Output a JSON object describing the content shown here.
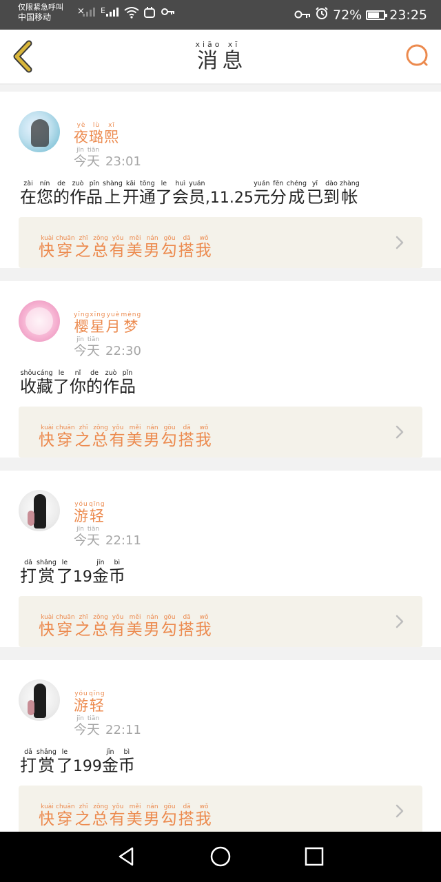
{
  "status_bar": {
    "carrier_line1": "仅限紧急呼叫",
    "carrier_line2": "中国移动",
    "network_type": "E",
    "battery_percent": "72%",
    "battery_level": 0.72,
    "time": "23:25"
  },
  "header": {
    "title": [
      [
        "消",
        "xiāo"
      ],
      [
        "息",
        "xī"
      ]
    ]
  },
  "messages": [
    {
      "username": [
        [
          "夜",
          "yè"
        ],
        [
          "璐",
          "lù"
        ],
        [
          "熙",
          "xī"
        ]
      ],
      "date": [
        [
          "今",
          "jīn"
        ],
        [
          "天",
          "tiān"
        ]
      ],
      "time": "23:01",
      "text": [
        [
          "在",
          "zài"
        ],
        [
          "您",
          "nín"
        ],
        [
          "的",
          "de"
        ],
        [
          "作",
          "zuò"
        ],
        [
          "品",
          "pǐn"
        ],
        [
          "上",
          "shàng"
        ],
        [
          "开",
          "kāi"
        ],
        [
          "通",
          "tōng"
        ],
        [
          "了",
          "le"
        ],
        [
          "会",
          "huì"
        ],
        [
          "员",
          "yuán"
        ],
        [
          ",11.25",
          ""
        ],
        [
          "元",
          "yuán"
        ],
        [
          "分",
          "fēn"
        ],
        [
          "成",
          "chéng"
        ],
        [
          "已",
          "yǐ"
        ],
        [
          "到",
          "dào"
        ],
        [
          "帐",
          "zhàng"
        ]
      ],
      "work_title": [
        [
          "快",
          "kuài"
        ],
        [
          "穿",
          "chuān"
        ],
        [
          "之",
          "zhī"
        ],
        [
          "总",
          "zǒng"
        ],
        [
          "有",
          "yǒu"
        ],
        [
          "美",
          "měi"
        ],
        [
          "男",
          "nán"
        ],
        [
          "勾",
          "gōu"
        ],
        [
          "搭",
          "dā"
        ],
        [
          "我",
          "wǒ"
        ]
      ]
    },
    {
      "username": [
        [
          "樱",
          "yīng"
        ],
        [
          "星",
          "xīng"
        ],
        [
          "月",
          "yuè"
        ],
        [
          "梦",
          "mèng"
        ]
      ],
      "date": [
        [
          "今",
          "jīn"
        ],
        [
          "天",
          "tiān"
        ]
      ],
      "time": "22:30",
      "text": [
        [
          "收",
          "shōu"
        ],
        [
          "藏",
          "cáng"
        ],
        [
          "了",
          "le"
        ],
        [
          "你",
          "nǐ"
        ],
        [
          "的",
          "de"
        ],
        [
          "作",
          "zuò"
        ],
        [
          "品",
          "pǐn"
        ]
      ],
      "work_title": [
        [
          "快",
          "kuài"
        ],
        [
          "穿",
          "chuān"
        ],
        [
          "之",
          "zhī"
        ],
        [
          "总",
          "zǒng"
        ],
        [
          "有",
          "yǒu"
        ],
        [
          "美",
          "měi"
        ],
        [
          "男",
          "nán"
        ],
        [
          "勾",
          "gōu"
        ],
        [
          "搭",
          "dā"
        ],
        [
          "我",
          "wǒ"
        ]
      ]
    },
    {
      "username": [
        [
          "游",
          "yóu"
        ],
        [
          "轻",
          "qīng"
        ]
      ],
      "date": [
        [
          "今",
          "jīn"
        ],
        [
          "天",
          "tiān"
        ]
      ],
      "time": "22:11",
      "text": [
        [
          "打",
          "dǎ"
        ],
        [
          "赏",
          "shǎng"
        ],
        [
          "了",
          "le"
        ],
        [
          "19",
          ""
        ],
        [
          "金",
          "jīn"
        ],
        [
          "币",
          "bì"
        ]
      ],
      "work_title": [
        [
          "快",
          "kuài"
        ],
        [
          "穿",
          "chuān"
        ],
        [
          "之",
          "zhī"
        ],
        [
          "总",
          "zǒng"
        ],
        [
          "有",
          "yǒu"
        ],
        [
          "美",
          "měi"
        ],
        [
          "男",
          "nán"
        ],
        [
          "勾",
          "gōu"
        ],
        [
          "搭",
          "dā"
        ],
        [
          "我",
          "wǒ"
        ]
      ]
    },
    {
      "username": [
        [
          "游",
          "yóu"
        ],
        [
          "轻",
          "qīng"
        ]
      ],
      "date": [
        [
          "今",
          "jīn"
        ],
        [
          "天",
          "tiān"
        ]
      ],
      "time": "22:11",
      "text": [
        [
          "打",
          "dǎ"
        ],
        [
          "赏",
          "shǎng"
        ],
        [
          "了",
          "le"
        ],
        [
          "199",
          ""
        ],
        [
          "金",
          "jīn"
        ],
        [
          "币",
          "bì"
        ]
      ],
      "work_title": [
        [
          "快",
          "kuài"
        ],
        [
          "穿",
          "chuān"
        ],
        [
          "之",
          "zhī"
        ],
        [
          "总",
          "zǒng"
        ],
        [
          "有",
          "yǒu"
        ],
        [
          "美",
          "měi"
        ],
        [
          "男",
          "nán"
        ],
        [
          "勾",
          "gōu"
        ],
        [
          "搭",
          "dā"
        ],
        [
          "我",
          "wǒ"
        ]
      ]
    }
  ],
  "icons": {
    "back": "chevron-left-icon",
    "search": "search-icon",
    "link_arrow": "chevron-right-icon",
    "nav_back": "triangle-back-icon",
    "nav_home": "circle-home-icon",
    "nav_recents": "square-recents-icon"
  },
  "colors": {
    "accent": "#ec8a4e",
    "back_icon": "#d9b63a",
    "card_link_bg": "#f4f2ea",
    "muted_text": "#a6a6a6",
    "page_bg": "#f2f2f2"
  }
}
